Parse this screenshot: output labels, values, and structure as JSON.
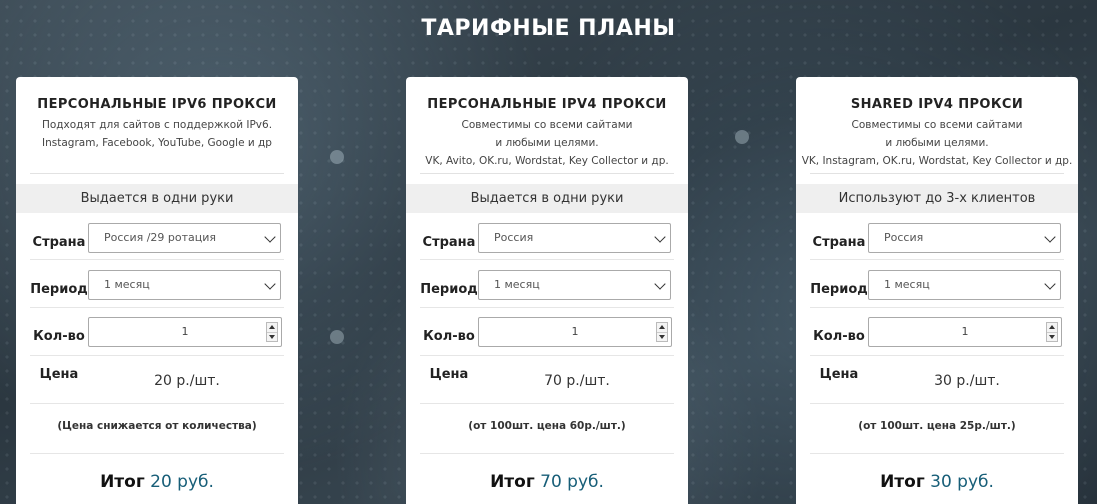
{
  "page": {
    "title": "ТАРИФНЫЕ ПЛАНЫ"
  },
  "colors": {
    "accent": "#175e78",
    "band": "#efefef"
  },
  "plans": [
    {
      "title": "ПЕРСОНАЛЬНЫЕ IPV6 ПРОКСИ",
      "desc_lines": [
        "Подходят для сайтов с поддержкой IPv6.",
        "Instagram, Facebook, YouTube, Google и др"
      ],
      "usage": "Выдается в одни руки",
      "country_label": "Страна",
      "country_value": "Россия /29 ротация",
      "period_label": "Период",
      "period_value": "1 месяц",
      "qty_label": "Кол-во",
      "qty_value": "1",
      "price_label": "Цена",
      "price_value": "20 р./шт.",
      "note": "(Цена снижается от количества)",
      "total_label": "Итог",
      "total_value": "20 руб."
    },
    {
      "title": "ПЕРСОНАЛЬНЫЕ IPV4 ПРОКСИ",
      "desc_lines": [
        "Совместимы со всеми сайтами",
        "и любыми целями.",
        "VK, Avito, OK.ru, Wordstat, Key Collector и др."
      ],
      "usage": "Выдается в одни руки",
      "country_label": "Страна",
      "country_value": "Россия",
      "period_label": "Период",
      "period_value": "1 месяц",
      "qty_label": "Кол-во",
      "qty_value": "1",
      "price_label": "Цена",
      "price_value": "70 р./шт.",
      "note": "(от 100шт. цена 60р./шт.)",
      "total_label": "Итог",
      "total_value": "70 руб."
    },
    {
      "title": "SHARED IPV4 ПРОКСИ",
      "desc_lines": [
        "Совместимы со всеми сайтами",
        "и любыми целями.",
        "VK, Instagram, OK.ru, Wordstat, Key Collector и др."
      ],
      "usage": "Используют до 3-х клиентов",
      "country_label": "Страна",
      "country_value": "Россия",
      "period_label": "Период",
      "period_value": "1 месяц",
      "qty_label": "Кол-во",
      "qty_value": "1",
      "price_label": "Цена",
      "price_value": "30 р./шт.",
      "note": "(от 100шт. цена 25р./шт.)",
      "total_label": "Итог",
      "total_value": "30 руб."
    }
  ]
}
